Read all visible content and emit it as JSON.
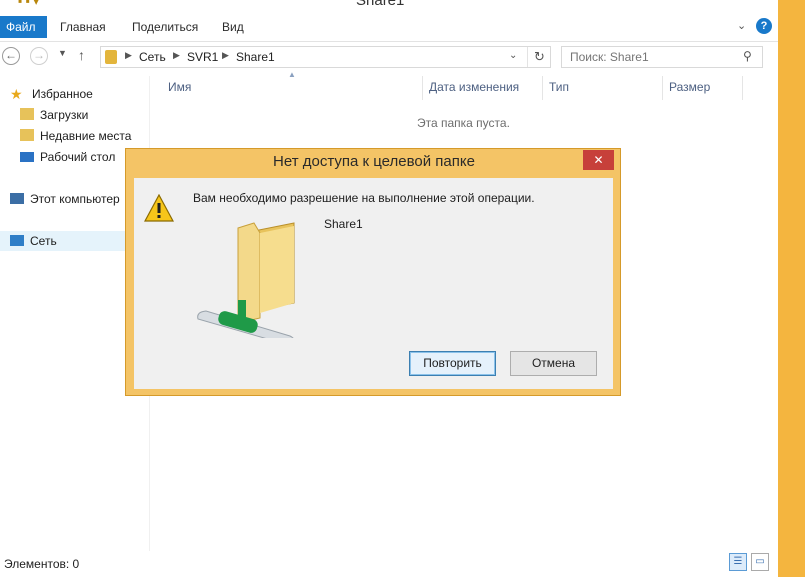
{
  "window": {
    "title": "Share1"
  },
  "ribbon": {
    "tabs": [
      "Файл",
      "Главная",
      "Поделиться",
      "Вид"
    ],
    "help": "?"
  },
  "address": {
    "breadcrumbs": [
      "Сеть",
      "SVR1",
      "Share1"
    ],
    "search_placeholder": "Поиск: Share1"
  },
  "sidebar": {
    "items": [
      {
        "label": "Избранное",
        "icon": "star-icon"
      },
      {
        "label": "Загрузки",
        "icon": "downloads-icon"
      },
      {
        "label": "Недавние места",
        "icon": "recent-places-icon"
      },
      {
        "label": "Рабочий стол",
        "icon": "desktop-icon"
      },
      {
        "label": "Этот компьютер",
        "icon": "computer-icon"
      },
      {
        "label": "Сеть",
        "icon": "network-icon",
        "selected": true
      }
    ]
  },
  "content": {
    "columns": [
      "Имя",
      "Дата изменения",
      "Тип",
      "Размер"
    ],
    "empty_text": "Эта папка пуста."
  },
  "status": {
    "items_count": "Элементов: 0"
  },
  "dialog": {
    "title": "Нет доступа к целевой папке",
    "message": "Вам необходимо разрешение на выполнение этой операции.",
    "folder": "Share1",
    "retry_label": "Повторить",
    "cancel_label": "Отмена",
    "close_symbol": "✕"
  },
  "colors": {
    "accent": "#1979ca",
    "dialog_frame": "#f4c466",
    "close_button": "#c7403a",
    "desktop": "#f4b53f"
  }
}
